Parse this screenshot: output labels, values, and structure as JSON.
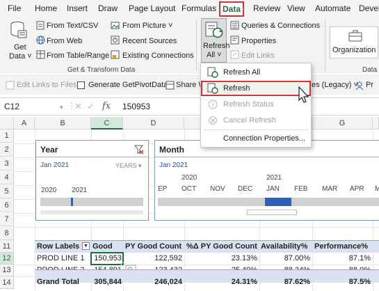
{
  "menu": {
    "tabs": [
      "File",
      "Home",
      "Insert",
      "Draw",
      "Page Layout",
      "Formulas",
      "Data",
      "Review",
      "View",
      "Automate",
      "Devel"
    ],
    "active": "Data"
  },
  "ribbon": {
    "get_data": {
      "line1": "Get",
      "line2": "Data ˅"
    },
    "from_text_csv": "From Text/CSV",
    "from_web": "From Web",
    "from_table_range": "From Table/Range",
    "from_picture": "From Picture ˅",
    "recent_sources": "Recent Sources",
    "existing_connections": "Existing Connections",
    "group_get_transform": "Get & Transform Data",
    "refresh_all": {
      "line1": "Refresh",
      "line2": "All ˅"
    },
    "queries_connections": "Queries & Connections",
    "properties": "Properties",
    "edit_links": "Edit Links",
    "organization": "Organization",
    "group_data_types": "Data T"
  },
  "toolbar2": {
    "edit_links_to_files": "Edit Links to Files",
    "generate_getpivotdata": "Generate GetPivotData",
    "share_w": "Share W",
    "legacy": "es (Legacy) ˅",
    "pr": "Pr"
  },
  "formula_bar": {
    "name_box": "C12",
    "fx": "fx",
    "value": "150953"
  },
  "columns": [
    "A",
    "B",
    "C",
    "D",
    "E",
    "F",
    "G"
  ],
  "selected_column": "C",
  "rows": [
    "1",
    "2",
    "3",
    "4",
    "5",
    "6",
    "7",
    "8",
    "9",
    "10",
    "11",
    "12",
    "13",
    "14"
  ],
  "selected_row": "12",
  "slicer_year": {
    "title": "Year",
    "period": "Jan 2021",
    "unit": "YEARS ▾",
    "years": [
      "2020",
      "2021"
    ]
  },
  "slicer_month": {
    "title": "Month",
    "period": "Jan 2021",
    "years": [
      "2020",
      "2021"
    ],
    "months": [
      "EP",
      "OCT",
      "NOV",
      "DEC",
      "JAN",
      "FEB",
      "MAR",
      "APR",
      "MA"
    ],
    "selected_month": "JAN"
  },
  "pivot": {
    "headers": [
      "Row Labels",
      "Good",
      "PY Good Count",
      "%Δ PY Good Count",
      "Availability%",
      "Performance%"
    ],
    "rows": [
      [
        "PROD LINE 1",
        "150,953",
        "122,592",
        "23.13%",
        "87.00%",
        "87.1%"
      ],
      [
        "PROD LINE 2",
        "154,891",
        "123,432",
        "25.49%",
        "88.24%",
        "88.0%"
      ]
    ],
    "total": [
      "Grand Total",
      "305,844",
      "246,024",
      "24.31%",
      "87.62%",
      "87.5%"
    ]
  },
  "dropdown": {
    "items": [
      {
        "label": "Refresh All",
        "enabled": true
      },
      {
        "label": "Refresh",
        "enabled": true,
        "highlighted": true
      },
      {
        "label": "Refresh Status",
        "enabled": false
      },
      {
        "label": "Cancel Refresh",
        "enabled": false
      },
      {
        "label": "Connection Properties...",
        "enabled": true
      }
    ]
  },
  "colors": {
    "excel_green": "#1e6e3b",
    "highlight_red": "#d0353a",
    "slicer_blue": "#2f5fb3",
    "pivot_header": "#d9e1f2"
  }
}
